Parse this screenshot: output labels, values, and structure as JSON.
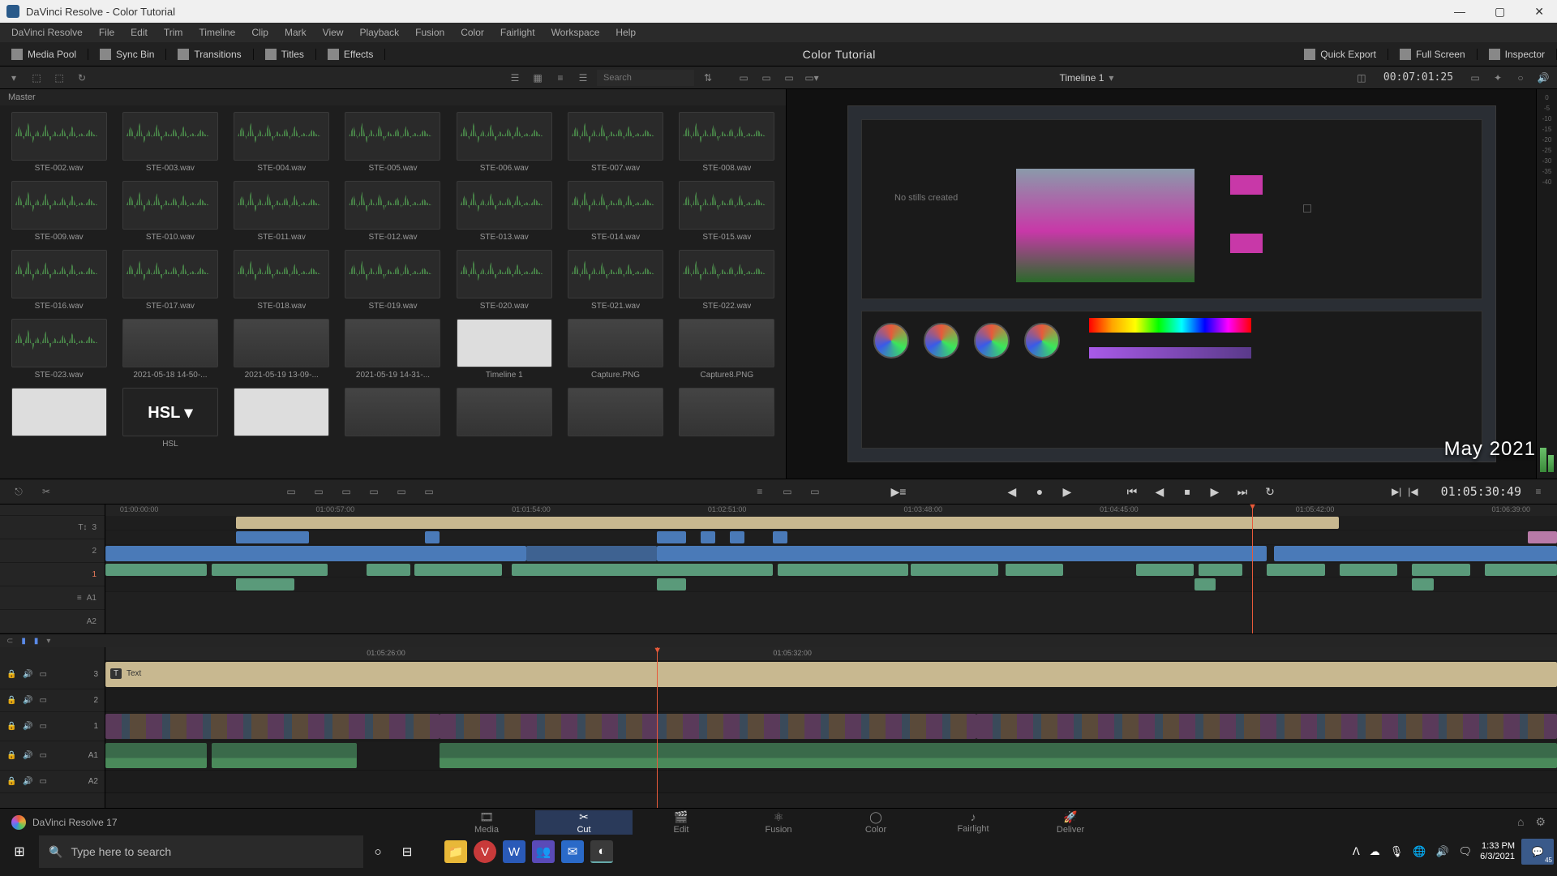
{
  "window": {
    "title": "DaVinci Resolve - Color Tutorial"
  },
  "menus": [
    "DaVinci Resolve",
    "File",
    "Edit",
    "Trim",
    "Timeline",
    "Clip",
    "Mark",
    "View",
    "Playback",
    "Fusion",
    "Color",
    "Fairlight",
    "Workspace",
    "Help"
  ],
  "toolbar": {
    "left": [
      {
        "label": "Media Pool",
        "icon": "media-pool-icon"
      },
      {
        "label": "Sync Bin",
        "icon": "sync-bin-icon"
      },
      {
        "label": "Transitions",
        "icon": "transitions-icon"
      },
      {
        "label": "Titles",
        "icon": "titles-icon"
      },
      {
        "label": "Effects",
        "icon": "effects-icon"
      }
    ],
    "center_title": "Color Tutorial",
    "right": [
      {
        "label": "Quick Export",
        "icon": "export-icon"
      },
      {
        "label": "Full Screen",
        "icon": "fullscreen-icon"
      },
      {
        "label": "Inspector",
        "icon": "inspector-icon"
      }
    ]
  },
  "subtool": {
    "search_placeholder": "Search",
    "timeline_name": "Timeline 1",
    "timecode": "00:07:01:25"
  },
  "pool": {
    "breadcrumb": "Master",
    "clips": [
      {
        "name": "STE-002.wav",
        "kind": "audio"
      },
      {
        "name": "STE-003.wav",
        "kind": "audio"
      },
      {
        "name": "STE-004.wav",
        "kind": "audio"
      },
      {
        "name": "STE-005.wav",
        "kind": "audio"
      },
      {
        "name": "STE-006.wav",
        "kind": "audio"
      },
      {
        "name": "STE-007.wav",
        "kind": "audio"
      },
      {
        "name": "STE-008.wav",
        "kind": "audio"
      },
      {
        "name": "STE-009.wav",
        "kind": "audio"
      },
      {
        "name": "STE-010.wav",
        "kind": "audio"
      },
      {
        "name": "STE-011.wav",
        "kind": "audio"
      },
      {
        "name": "STE-012.wav",
        "kind": "audio"
      },
      {
        "name": "STE-013.wav",
        "kind": "audio"
      },
      {
        "name": "STE-014.wav",
        "kind": "audio"
      },
      {
        "name": "STE-015.wav",
        "kind": "audio"
      },
      {
        "name": "STE-016.wav",
        "kind": "audio"
      },
      {
        "name": "STE-017.wav",
        "kind": "audio"
      },
      {
        "name": "STE-018.wav",
        "kind": "audio"
      },
      {
        "name": "STE-019.wav",
        "kind": "audio"
      },
      {
        "name": "STE-020.wav",
        "kind": "audio"
      },
      {
        "name": "STE-021.wav",
        "kind": "audio"
      },
      {
        "name": "STE-022.wav",
        "kind": "audio"
      },
      {
        "name": "STE-023.wav",
        "kind": "audio"
      },
      {
        "name": "2021-05-18 14-50-...",
        "kind": "vid"
      },
      {
        "name": "2021-05-19 13-09-...",
        "kind": "vid"
      },
      {
        "name": "2021-05-19 14-31-...",
        "kind": "vid"
      },
      {
        "name": "Timeline 1",
        "kind": "img"
      },
      {
        "name": "Capture.PNG",
        "kind": "vid"
      },
      {
        "name": "Capture8.PNG",
        "kind": "vid"
      },
      {
        "name": "",
        "kind": "img"
      },
      {
        "name": "HSL",
        "kind": "img"
      },
      {
        "name": "",
        "kind": "img"
      },
      {
        "name": "",
        "kind": "vid"
      },
      {
        "name": "",
        "kind": "vid"
      },
      {
        "name": "",
        "kind": "vid"
      },
      {
        "name": "",
        "kind": "vid"
      }
    ]
  },
  "viewer": {
    "overlay_text": "May 2021",
    "meter_ticks": [
      "0",
      "-5",
      "-10",
      "-15",
      "-20",
      "-25",
      "-30",
      "-35",
      "-40"
    ]
  },
  "transport_tc": "01:05:30:49",
  "upper_timeline": {
    "ruler": [
      "01:00:00:00",
      "01:00:57:00",
      "01:01:54:00",
      "01:02:51:00",
      "01:03:48:00",
      "01:04:45:00",
      "01:05:42:00",
      "01:06:39:00"
    ],
    "tracks": [
      "3",
      "2",
      "1",
      "A1",
      "A2"
    ],
    "playhead_pct": 79
  },
  "lower_timeline": {
    "ruler": [
      "01:05:26:00",
      "01:05:32:00"
    ],
    "tracks": [
      {
        "label": "3",
        "kind": "tan"
      },
      {
        "label": "2",
        "kind": "empty"
      },
      {
        "label": "1",
        "kind": "vid"
      },
      {
        "label": "A1",
        "kind": "aud"
      },
      {
        "label": "A2",
        "kind": "empty"
      }
    ],
    "text_clip_label": "Text",
    "playhead_pct": 38
  },
  "pages": [
    {
      "label": "Media",
      "icon": "🎞"
    },
    {
      "label": "Cut",
      "icon": "✂",
      "active": true
    },
    {
      "label": "Edit",
      "icon": "🎬"
    },
    {
      "label": "Fusion",
      "icon": "⚛"
    },
    {
      "label": "Color",
      "icon": "◯"
    },
    {
      "label": "Fairlight",
      "icon": "♪"
    },
    {
      "label": "Deliver",
      "icon": "🚀"
    }
  ],
  "brand": "DaVinci Resolve 17",
  "taskbar": {
    "search_placeholder": "Type here to search",
    "time": "1:33 PM",
    "date": "6/3/2021",
    "notif_count": "45"
  }
}
